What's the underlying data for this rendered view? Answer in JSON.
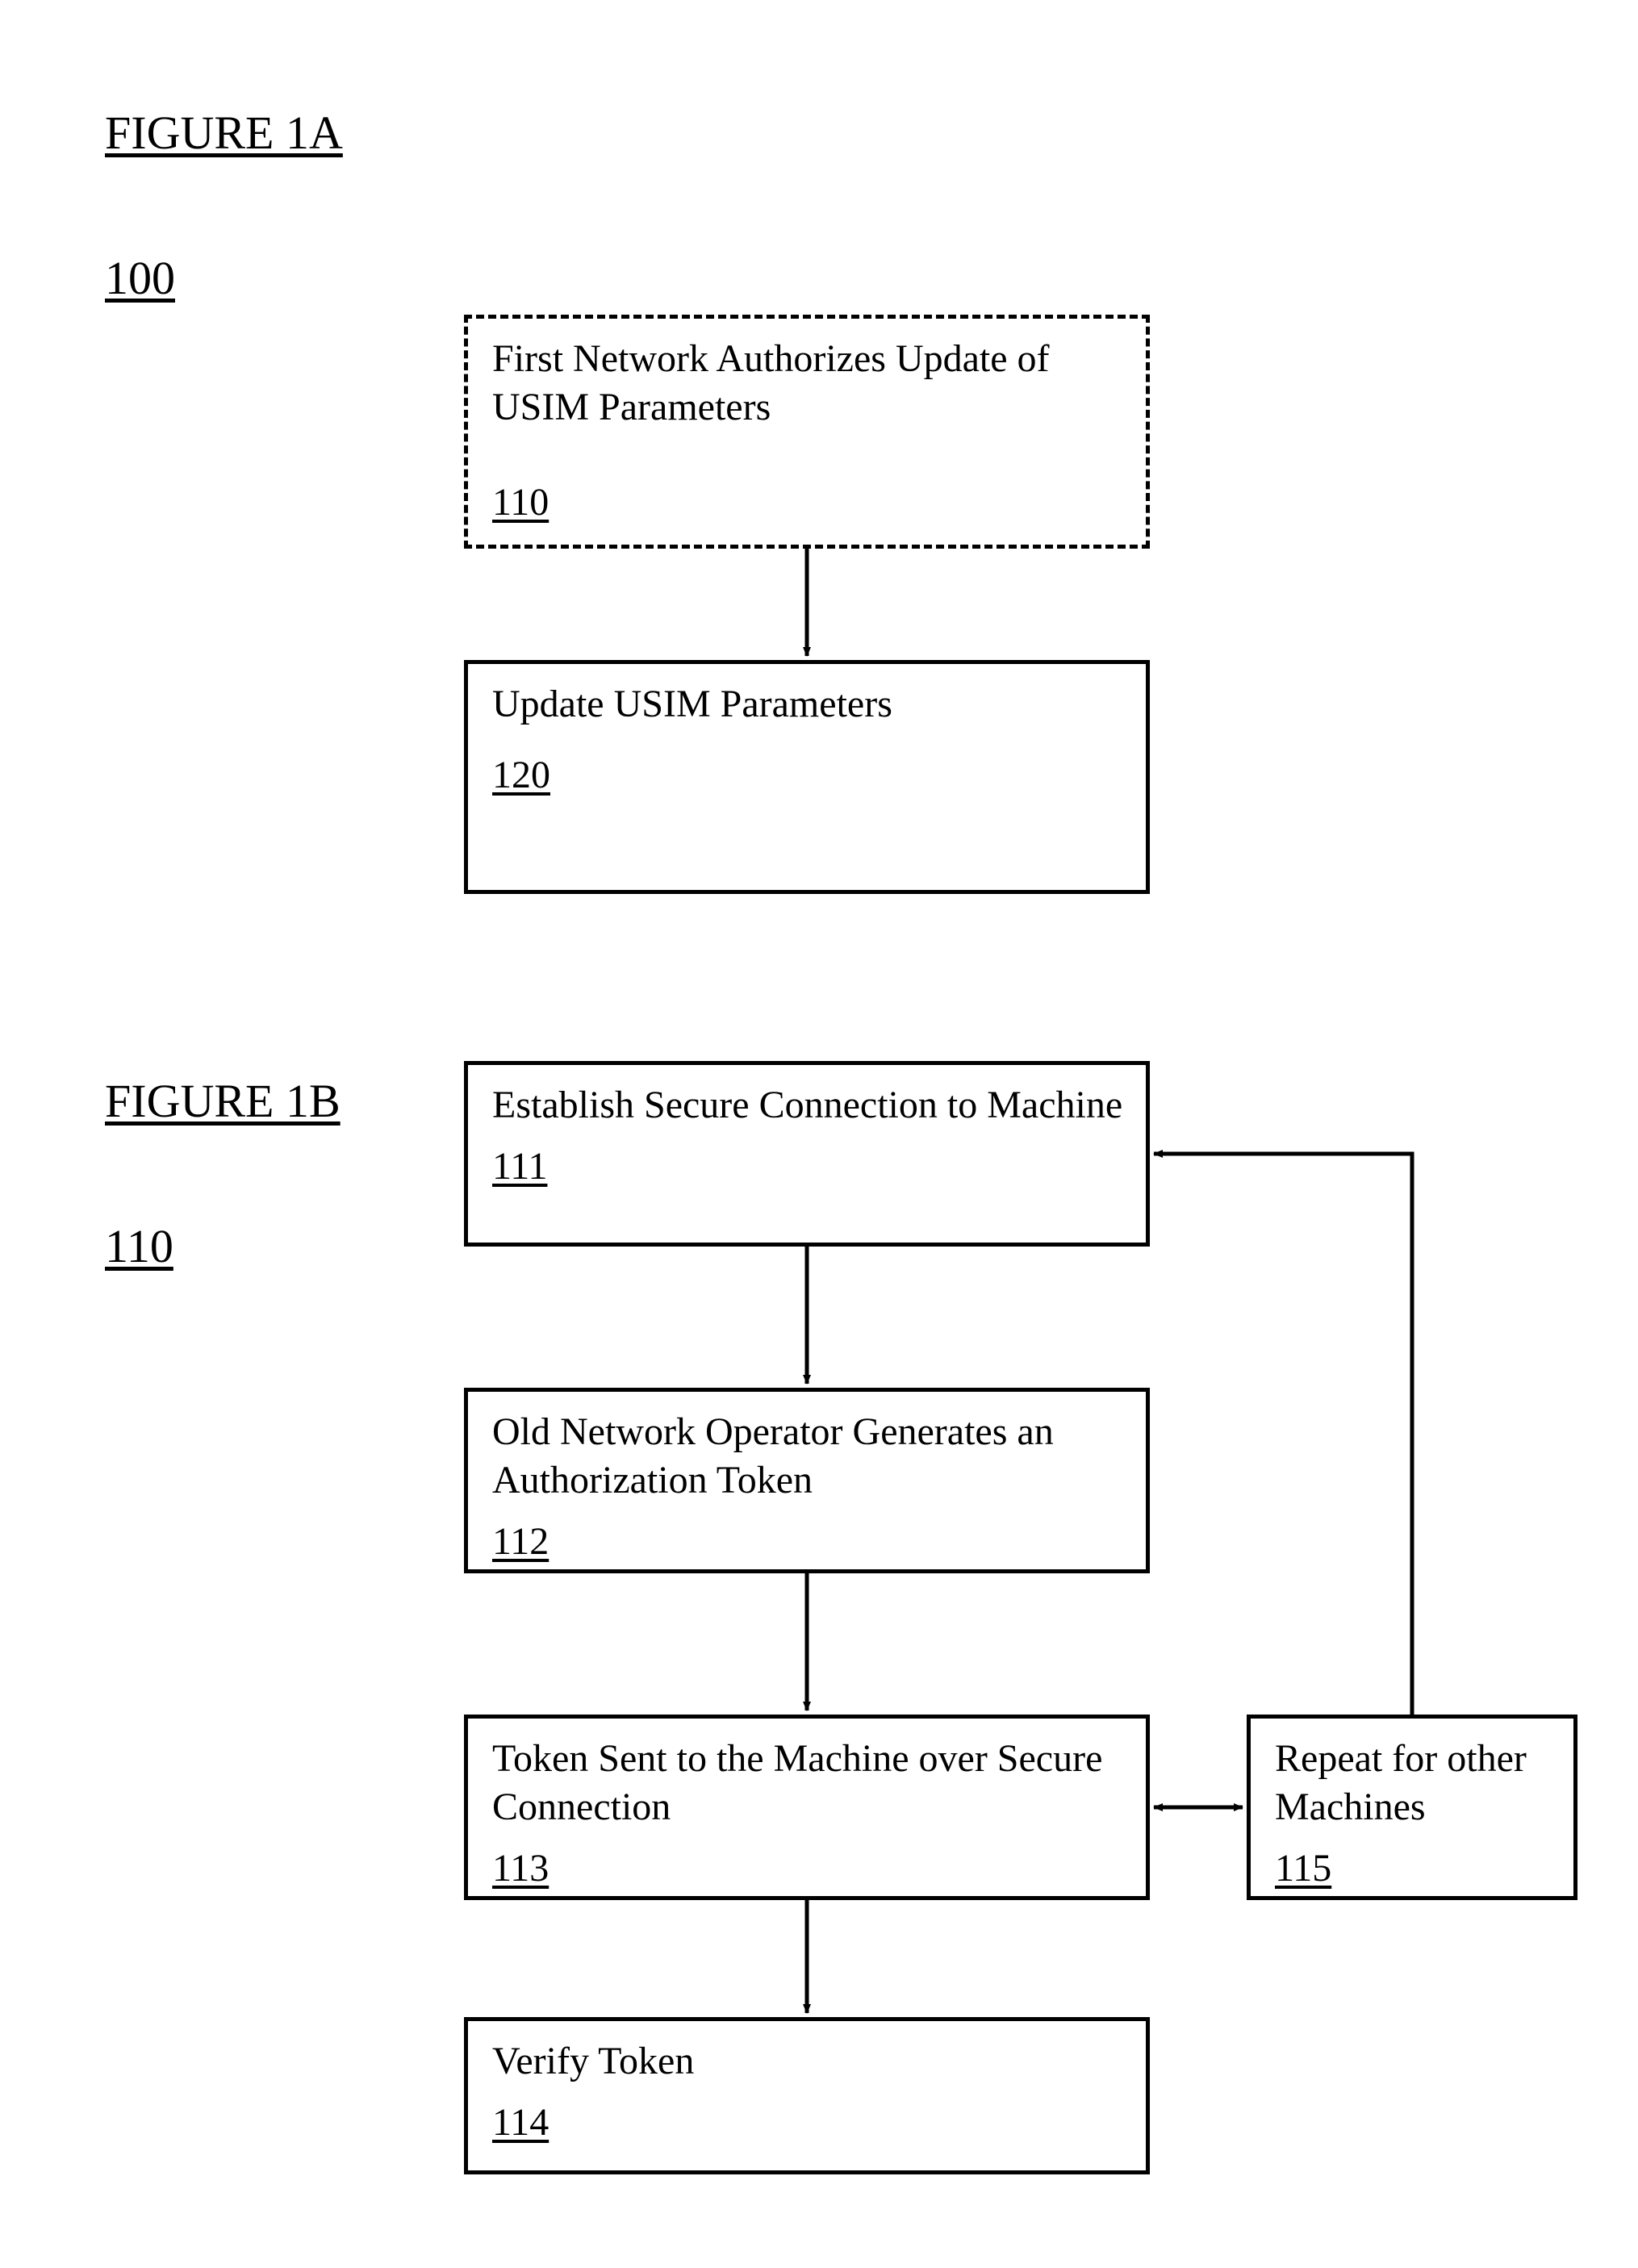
{
  "figA": {
    "title": "FIGURE 1A",
    "ref": "100",
    "box110": {
      "text": "First Network Authorizes Update of USIM Parameters",
      "num": "110"
    },
    "box120": {
      "text": "Update USIM Parameters",
      "num": "120"
    }
  },
  "figB": {
    "title": "FIGURE 1B",
    "ref": "110",
    "box111": {
      "text": "Establish Secure Connection to Machine",
      "num": "111"
    },
    "box112": {
      "text": "Old Network Operator Generates an Authorization Token",
      "num": "112"
    },
    "box113": {
      "text": "Token Sent to the Machine over Secure Connection",
      "num": "113"
    },
    "box114": {
      "text": "Verify Token",
      "num": "114"
    },
    "box115": {
      "text": "Repeat for other Machines",
      "num": "115"
    }
  }
}
